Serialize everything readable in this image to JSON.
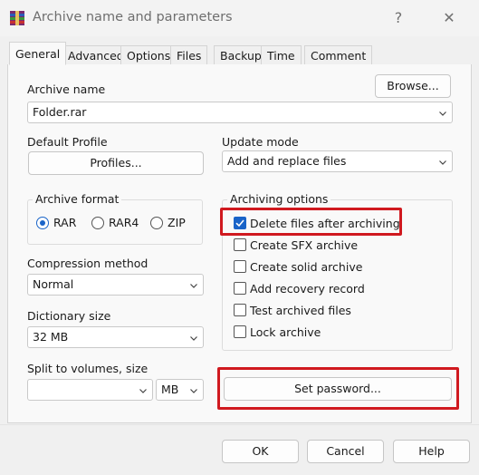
{
  "window": {
    "title": "Archive name and parameters",
    "help_glyph": "?",
    "close_glyph": "✕"
  },
  "tabs": [
    {
      "label": "General",
      "active": true
    },
    {
      "label": "Advanced",
      "active": false
    },
    {
      "label": "Options",
      "active": false
    },
    {
      "label": "Files",
      "active": false
    },
    {
      "label": "Backup",
      "active": false
    },
    {
      "label": "Time",
      "active": false
    },
    {
      "label": "Comment",
      "active": false
    }
  ],
  "archive_name": {
    "label": "Archive name",
    "value": "Folder.rar",
    "browse_label": "Browse..."
  },
  "default_profile": {
    "label": "Default Profile",
    "profiles_label": "Profiles..."
  },
  "update_mode": {
    "label": "Update mode",
    "value": "Add and replace files"
  },
  "archive_format": {
    "label": "Archive format",
    "options": [
      {
        "label": "RAR",
        "checked": true
      },
      {
        "label": "RAR4",
        "checked": false
      },
      {
        "label": "ZIP",
        "checked": false
      }
    ]
  },
  "compression_method": {
    "label": "Compression method",
    "value": "Normal"
  },
  "dictionary_size": {
    "label": "Dictionary size",
    "value": "32 MB"
  },
  "split_volumes": {
    "label": "Split to volumes, size",
    "value": "",
    "unit": "MB"
  },
  "archiving_options": {
    "label": "Archiving options",
    "items": [
      {
        "label": "Delete files after archiving",
        "checked": true
      },
      {
        "label": "Create SFX archive",
        "checked": false
      },
      {
        "label": "Create solid archive",
        "checked": false
      },
      {
        "label": "Add recovery record",
        "checked": false
      },
      {
        "label": "Test archived files",
        "checked": false
      },
      {
        "label": "Lock archive",
        "checked": false
      }
    ]
  },
  "set_password_label": "Set password...",
  "footer": {
    "ok_label": "OK",
    "cancel_label": "Cancel",
    "help_label": "Help"
  },
  "colors": {
    "accent": "#1a64c8",
    "highlight": "#d0191f"
  }
}
